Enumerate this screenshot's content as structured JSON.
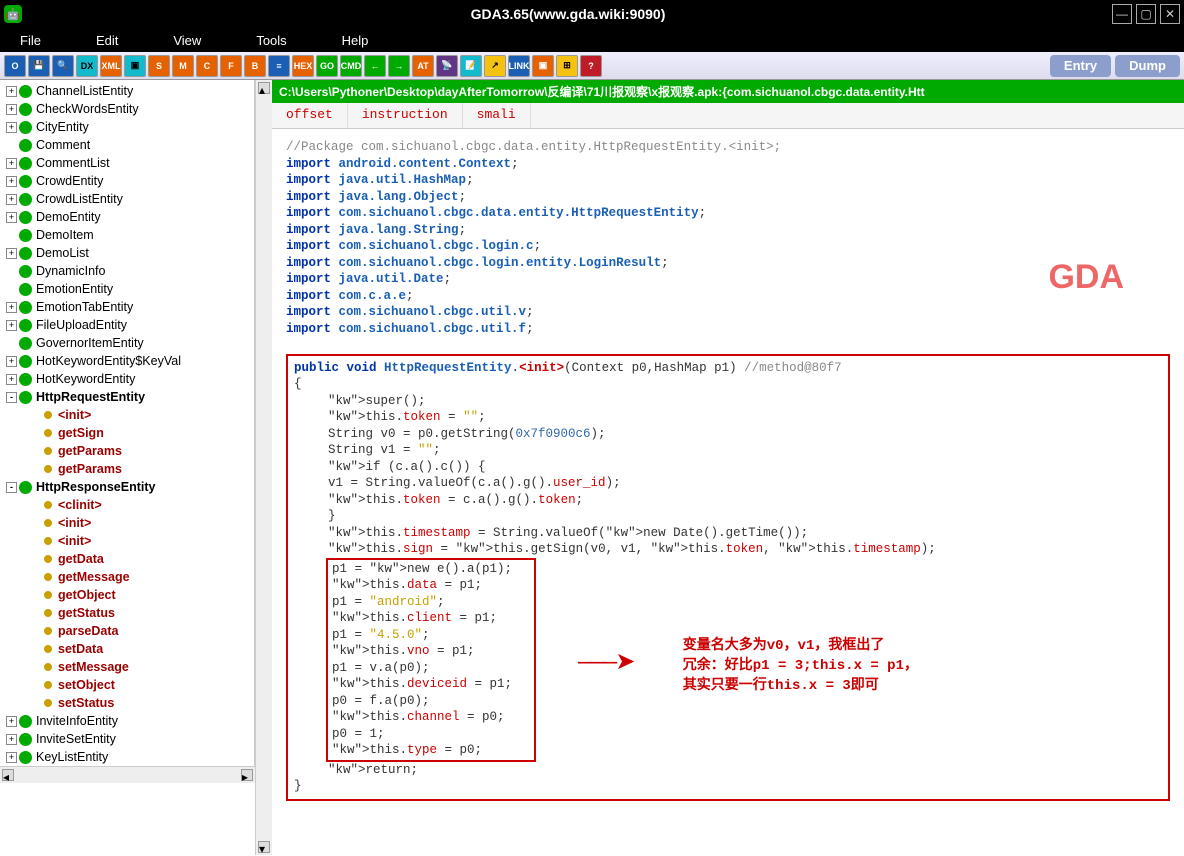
{
  "title": "GDA3.65(www.gda.wiki:9090)",
  "menu": [
    "File",
    "Edit",
    "View",
    "Tools",
    "Help"
  ],
  "toolbar_icons": [
    {
      "n": "refresh",
      "c": "blue",
      "t": "O"
    },
    {
      "n": "save",
      "c": "blue",
      "t": "💾"
    },
    {
      "n": "search",
      "c": "blue",
      "t": "🔍"
    },
    {
      "n": "dex",
      "c": "cyan",
      "t": "DX"
    },
    {
      "n": "xml",
      "c": "orange",
      "t": "XML"
    },
    {
      "n": "screen",
      "c": "cyan",
      "t": "▣"
    },
    {
      "n": "s",
      "c": "orange",
      "t": "S"
    },
    {
      "n": "m",
      "c": "orange",
      "t": "M"
    },
    {
      "n": "c",
      "c": "orange",
      "t": "C"
    },
    {
      "n": "f",
      "c": "orange",
      "t": "F"
    },
    {
      "n": "b",
      "c": "orange",
      "t": "B"
    },
    {
      "n": "bars",
      "c": "blue",
      "t": "≡"
    },
    {
      "n": "hex",
      "c": "orange",
      "t": "HEX"
    },
    {
      "n": "go",
      "c": "green",
      "t": "GO"
    },
    {
      "n": "cmd",
      "c": "green",
      "t": "CMD"
    },
    {
      "n": "back",
      "c": "green",
      "t": "←"
    },
    {
      "n": "fwd",
      "c": "green",
      "t": "→"
    },
    {
      "n": "at",
      "c": "orange",
      "t": "AT"
    },
    {
      "n": "antenna",
      "c": "purple",
      "t": "📡"
    },
    {
      "n": "note",
      "c": "cyan",
      "t": "📝"
    },
    {
      "n": "out",
      "c": "yellow",
      "t": "↗"
    },
    {
      "n": "link",
      "c": "blue",
      "t": "LINK"
    },
    {
      "n": "box",
      "c": "orange",
      "t": "▣"
    },
    {
      "n": "grid",
      "c": "yellow",
      "t": "⊞"
    },
    {
      "n": "help",
      "c": "red",
      "t": "?"
    }
  ],
  "bigbtn_entry": "Entry",
  "bigbtn_dump": "Dump",
  "path": "C:\\Users\\Pythoner\\Desktop\\dayAfterTomorrow\\反编译\\71川报观察\\x报观察.apk:{com.sichuanol.cbgc.data.entity.Htt",
  "tabs": [
    "offset",
    "instruction",
    "smali"
  ],
  "tree": [
    {
      "l": 0,
      "exp": "+",
      "t": "ChannelListEntity"
    },
    {
      "l": 0,
      "exp": "+",
      "t": "CheckWordsEntity"
    },
    {
      "l": 0,
      "exp": "+",
      "t": "CityEntity"
    },
    {
      "l": 0,
      "exp": " ",
      "t": "Comment"
    },
    {
      "l": 0,
      "exp": "+",
      "t": "CommentList"
    },
    {
      "l": 0,
      "exp": "+",
      "t": "CrowdEntity"
    },
    {
      "l": 0,
      "exp": "+",
      "t": "CrowdListEntity"
    },
    {
      "l": 0,
      "exp": "+",
      "t": "DemoEntity"
    },
    {
      "l": 0,
      "exp": " ",
      "t": "DemoItem"
    },
    {
      "l": 0,
      "exp": "+",
      "t": "DemoList"
    },
    {
      "l": 0,
      "exp": " ",
      "t": "DynamicInfo"
    },
    {
      "l": 0,
      "exp": " ",
      "t": "EmotionEntity"
    },
    {
      "l": 0,
      "exp": "+",
      "t": "EmotionTabEntity"
    },
    {
      "l": 0,
      "exp": "+",
      "t": "FileUploadEntity"
    },
    {
      "l": 0,
      "exp": " ",
      "t": "GovernorItemEntity"
    },
    {
      "l": 0,
      "exp": "+",
      "t": "HotKeywordEntity$KeyVal"
    },
    {
      "l": 0,
      "exp": "+",
      "t": "HotKeywordEntity"
    },
    {
      "l": 0,
      "exp": "-",
      "t": "HttpRequestEntity",
      "bold": true
    },
    {
      "l": 1,
      "dot": true,
      "t": "<init>",
      "sel": true
    },
    {
      "l": 1,
      "dot": true,
      "t": "getSign",
      "sel": true
    },
    {
      "l": 1,
      "dot": true,
      "t": "getParams",
      "sel": true
    },
    {
      "l": 1,
      "dot": true,
      "t": "getParams",
      "sel": true
    },
    {
      "l": 0,
      "exp": "-",
      "t": "HttpResponseEntity",
      "bold": true
    },
    {
      "l": 1,
      "dot": true,
      "t": "<clinit>",
      "sel": true
    },
    {
      "l": 1,
      "dot": true,
      "t": "<init>",
      "sel": true
    },
    {
      "l": 1,
      "dot": true,
      "t": "<init>",
      "sel": true
    },
    {
      "l": 1,
      "dot": true,
      "t": "getData",
      "sel": true
    },
    {
      "l": 1,
      "dot": true,
      "t": "getMessage",
      "sel": true
    },
    {
      "l": 1,
      "dot": true,
      "t": "getObject",
      "sel": true
    },
    {
      "l": 1,
      "dot": true,
      "t": "getStatus",
      "sel": true
    },
    {
      "l": 1,
      "dot": true,
      "t": "parseData",
      "sel": true
    },
    {
      "l": 1,
      "dot": true,
      "t": "setData",
      "sel": true
    },
    {
      "l": 1,
      "dot": true,
      "t": "setMessage",
      "sel": true
    },
    {
      "l": 1,
      "dot": true,
      "t": "setObject",
      "sel": true
    },
    {
      "l": 1,
      "dot": true,
      "t": "setStatus",
      "sel": true
    },
    {
      "l": 0,
      "exp": "+",
      "t": "InviteInfoEntity"
    },
    {
      "l": 0,
      "exp": "+",
      "t": "InviteSetEntity"
    },
    {
      "l": 0,
      "exp": "+",
      "t": "KeyListEntity"
    }
  ],
  "code": {
    "pkg": "//Package com.sichuanol.cbgc.data.entity.HttpRequestEntity.<init>;",
    "imports": [
      "android.content.Context",
      "java.util.HashMap",
      "java.lang.Object",
      "com.sichuanol.cbgc.data.entity.HttpRequestEntity",
      "java.lang.String",
      "com.sichuanol.cbgc.login.c",
      "com.sichuanol.cbgc.login.entity.LoginResult",
      "java.util.Date",
      "com.c.a.e",
      "com.sichuanol.cbgc.util.v",
      "com.sichuanol.cbgc.util.f"
    ],
    "sig_pre": "public void ",
    "sig_cls": "HttpRequestEntity",
    "sig_method": "<init>",
    "sig_args": "(Context p0,HashMap p1)",
    "sig_cm": "   //method@80f7",
    "body1": [
      "super();",
      "this.token = \"\";",
      "String v0 = p0.getString(0x7f0900c6);",
      "String v1 = \"\";",
      "if (c.a().c()) {",
      "   v1 = String.valueOf(c.a().g().user_id);",
      "   this.token = c.a().g().token;",
      "}",
      "this.timestamp = String.valueOf(new Date().getTime());",
      "this.sign = this.getSign(v0, v1, this.token, this.timestamp);"
    ],
    "boxed": [
      "p1 = new e().a(p1);",
      "this.data = p1;",
      "p1 = \"android\";",
      "this.client = p1;",
      "p1 = \"4.5.0\";",
      "this.vno = p1;",
      "p1 = v.a(p0);",
      "this.deviceid = p1;",
      "p0 = f.a(p0);",
      "this.channel = p0;",
      "p0 = 1;",
      "this.type = p0;"
    ],
    "ret": "return;"
  },
  "watermark": "GDA",
  "annotation": "变量名大多为v0，v1，我框出了\n冗余：好比p1 = 3;this.x = p1，\n其实只要一行this.x = 3即可"
}
